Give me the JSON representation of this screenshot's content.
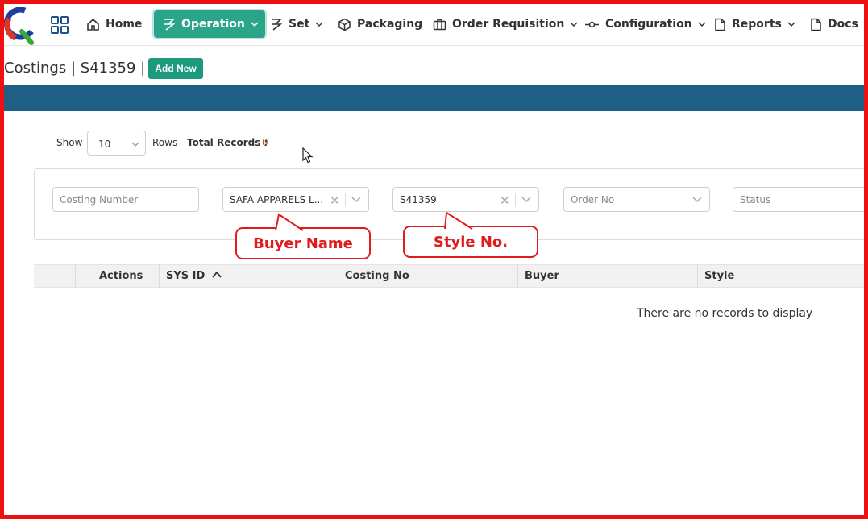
{
  "nav": {
    "items": [
      {
        "label": "Home",
        "icon": "home-icon"
      },
      {
        "label": "Operation",
        "icon": "operation-icon",
        "active": true
      },
      {
        "label": "Set",
        "icon": "set-icon"
      },
      {
        "label": "Packaging",
        "icon": "box-icon"
      },
      {
        "label": "Order Requisition",
        "icon": "briefcase-icon"
      },
      {
        "label": "Configuration",
        "icon": "commit-icon"
      },
      {
        "label": "Reports",
        "icon": "document-icon"
      },
      {
        "label": "Docs",
        "icon": "document-icon"
      }
    ]
  },
  "header": {
    "title": "Costings  |  S41359  |",
    "add_new_label": "Add New"
  },
  "toolbar": {
    "show_label": "Show",
    "rows_value": "10",
    "rows_label": "Rows",
    "total_label": "Total Records :",
    "total_value": "0"
  },
  "filters": {
    "costing_number_placeholder": "Costing Number",
    "buyer_value": "SAFA APPARELS L...",
    "style_value": "S41359",
    "order_no_placeholder": "Order No",
    "status_placeholder": "Status"
  },
  "callouts": {
    "buyer": "Buyer Name",
    "style": "Style No."
  },
  "table": {
    "columns": [
      "Actions",
      "SYS ID",
      "Costing No",
      "Buyer",
      "Style"
    ],
    "empty_message": "There are no records to display"
  },
  "colors": {
    "accent": "#2aa58a",
    "band": "#1f5f86",
    "annotation": "#e01b1b"
  }
}
